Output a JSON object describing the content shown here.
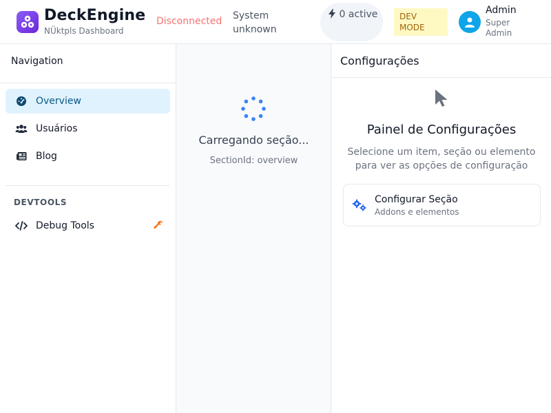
{
  "header": {
    "app_title": "DeckEngine",
    "app_subtitle": "NÜktpls Dashboard",
    "connection_status": "Disconnected",
    "system_status": "System unknown",
    "active_count": "0 active",
    "dev_badge": "DEV MODE",
    "user_name": "Admin",
    "user_role": "Super Admin"
  },
  "sidebar": {
    "title": "Navigation",
    "items": [
      {
        "label": "Overview",
        "icon": "dashboard-icon"
      },
      {
        "label": "Usuários",
        "icon": "users-icon"
      },
      {
        "label": "Blog",
        "icon": "newspaper-icon"
      }
    ],
    "devtools_heading": "DEVTOOLS",
    "devtools_items": [
      {
        "label": "Debug Tools",
        "icon": "code-icon",
        "badge_icon": "wrench-icon"
      }
    ]
  },
  "main": {
    "loading_text": "Carregando seção...",
    "section_id": "SectionId: overview"
  },
  "settings_panel": {
    "title": "Configurações",
    "heading": "Painel de Configurações",
    "description": "Selecione um item, seção ou elemento para ver as opções de configuração",
    "card": {
      "title": "Configurar Seção",
      "subtitle": "Addons e elementos",
      "icon": "cogs-icon"
    }
  },
  "colors": {
    "accent": "#0ea5e9",
    "active_nav_bg": "#e0f2fe",
    "disconnected": "#f87171",
    "dev_badge_bg": "#fef9c3",
    "spinner": "#3b82f6",
    "logo": "#7c3aed"
  }
}
